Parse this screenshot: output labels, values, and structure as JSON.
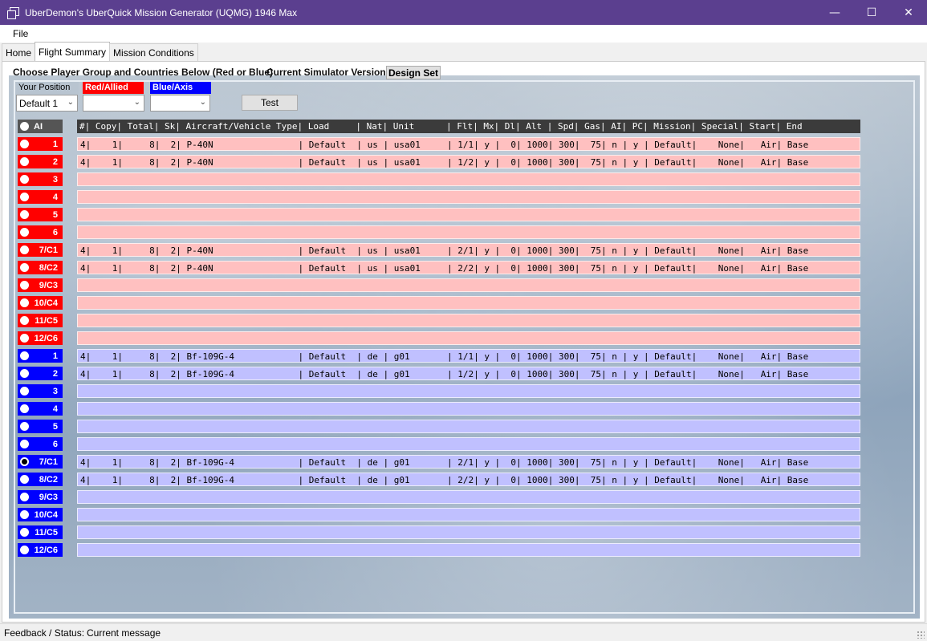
{
  "window": {
    "title": "UberDemon's UberQuick Mission Generator (UQMG) 1946 Max"
  },
  "menu": {
    "file": "File"
  },
  "tabs": [
    {
      "label": "Home"
    },
    {
      "label": "Flight Summary"
    },
    {
      "label": "Mission Conditions"
    }
  ],
  "header": {
    "choose": "Choose Player Group and Countries Below (Red or Blue)",
    "version_label": "Current Simulator Version:",
    "version_value": "Design Set"
  },
  "controls": {
    "position_label": "Your Position",
    "position_value": "Default 1",
    "red_label": "Red/Allied",
    "red_value": "",
    "blue_label": "Blue/Axis",
    "blue_value": "",
    "test_button": "Test"
  },
  "table_header": "#| Copy| Total| Sk| Aircraft/Vehicle Type| Load     | Nat| Unit      | Flt| Mx| Dl| Alt | Spd| Gas| AI| PC| Mission| Special| Start| End",
  "ai_label": "AI",
  "rows": [
    {
      "side": "red",
      "label": "1",
      "text": "4|    1|     8|  2| P-40N                | Default  | us | usa01     | 1/1| y |  0| 1000| 300|  75| n | y | Default|    None|   Air| Base",
      "selected": false
    },
    {
      "side": "red",
      "label": "2",
      "text": "4|    1|     8|  2| P-40N                | Default  | us | usa01     | 1/2| y |  0| 1000| 300|  75| n | y | Default|    None|   Air| Base",
      "selected": false
    },
    {
      "side": "red",
      "label": "3",
      "text": "",
      "selected": false
    },
    {
      "side": "red",
      "label": "4",
      "text": "",
      "selected": false
    },
    {
      "side": "red",
      "label": "5",
      "text": "",
      "selected": false
    },
    {
      "side": "red",
      "label": "6",
      "text": "",
      "selected": false
    },
    {
      "side": "red",
      "label": "7/C1",
      "text": "4|    1|     8|  2| P-40N                | Default  | us | usa01     | 2/1| y |  0| 1000| 300|  75| n | y | Default|    None|   Air| Base",
      "selected": false
    },
    {
      "side": "red",
      "label": "8/C2",
      "text": "4|    1|     8|  2| P-40N                | Default  | us | usa01     | 2/2| y |  0| 1000| 300|  75| n | y | Default|    None|   Air| Base",
      "selected": false
    },
    {
      "side": "red",
      "label": "9/C3",
      "text": "",
      "selected": false
    },
    {
      "side": "red",
      "label": "10/C4",
      "text": "",
      "selected": false
    },
    {
      "side": "red",
      "label": "11/C5",
      "text": "",
      "selected": false
    },
    {
      "side": "red",
      "label": "12/C6",
      "text": "",
      "selected": false
    },
    {
      "side": "blue",
      "label": "1",
      "text": "4|    1|     8|  2| Bf-109G-4            | Default  | de | g01       | 1/1| y |  0| 1000| 300|  75| n | y | Default|    None|   Air| Base",
      "selected": false
    },
    {
      "side": "blue",
      "label": "2",
      "text": "4|    1|     8|  2| Bf-109G-4            | Default  | de | g01       | 1/2| y |  0| 1000| 300|  75| n | y | Default|    None|   Air| Base",
      "selected": false
    },
    {
      "side": "blue",
      "label": "3",
      "text": "",
      "selected": false
    },
    {
      "side": "blue",
      "label": "4",
      "text": "",
      "selected": false
    },
    {
      "side": "blue",
      "label": "5",
      "text": "",
      "selected": false
    },
    {
      "side": "blue",
      "label": "6",
      "text": "",
      "selected": false
    },
    {
      "side": "blue",
      "label": "7/C1",
      "text": "4|    1|     8|  2| Bf-109G-4            | Default  | de | g01       | 2/1| y |  0| 1000| 300|  75| n | y | Default|    None|   Air| Base",
      "selected": true
    },
    {
      "side": "blue",
      "label": "8/C2",
      "text": "4|    1|     8|  2| Bf-109G-4            | Default  | de | g01       | 2/2| y |  0| 1000| 300|  75| n | y | Default|    None|   Air| Base",
      "selected": false
    },
    {
      "side": "blue",
      "label": "9/C3",
      "text": "",
      "selected": false
    },
    {
      "side": "blue",
      "label": "10/C4",
      "text": "",
      "selected": false
    },
    {
      "side": "blue",
      "label": "11/C5",
      "text": "",
      "selected": false
    },
    {
      "side": "blue",
      "label": "12/C6",
      "text": "",
      "selected": false
    }
  ],
  "status": {
    "label": "Feedback / Status:",
    "message": "Current message"
  },
  "colors": {
    "titlebar": "#5b3f8f",
    "red": "#ff0000",
    "blue": "#0000ff",
    "red_row": "#ffc0c0",
    "blue_row": "#c0c0ff"
  }
}
